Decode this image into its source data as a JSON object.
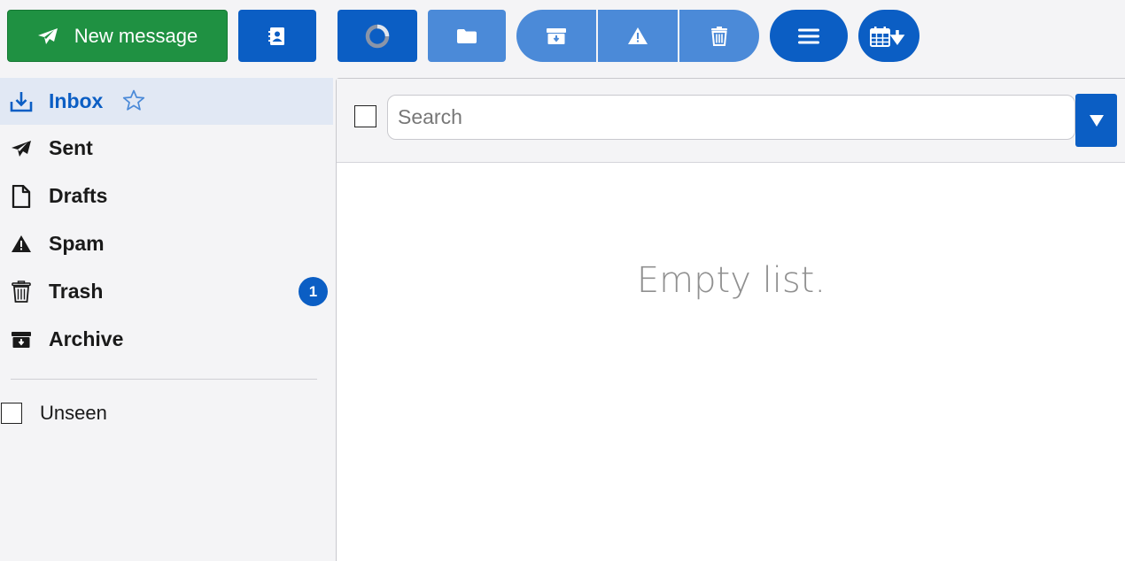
{
  "toolbar": {
    "new_message_label": "New message",
    "icons": {
      "new_message": "paper-plane-icon",
      "contacts": "address-book-icon",
      "refresh": "spinner-icon",
      "move": "folder-icon",
      "archive": "archive-icon",
      "spam": "warning-icon",
      "delete": "trash-icon",
      "menu": "hamburger-icon",
      "calendar": "calendar-download-icon"
    },
    "colors": {
      "primary": "#0b5ec4",
      "primary_light": "#4b8ad8",
      "success": "#1f9142"
    }
  },
  "sidebar": {
    "folders": [
      {
        "label": "Inbox",
        "icon": "inbox-download-icon",
        "active": true
      },
      {
        "label": "Sent",
        "icon": "paper-plane-icon"
      },
      {
        "label": "Drafts",
        "icon": "document-icon"
      },
      {
        "label": "Spam",
        "icon": "warning-icon"
      },
      {
        "label": "Trash",
        "icon": "trash-icon",
        "badge": "1"
      },
      {
        "label": "Archive",
        "icon": "archive-icon"
      }
    ],
    "unseen_label": "Unseen"
  },
  "messages": {
    "search_placeholder": "Search",
    "empty_text": "Empty list."
  }
}
